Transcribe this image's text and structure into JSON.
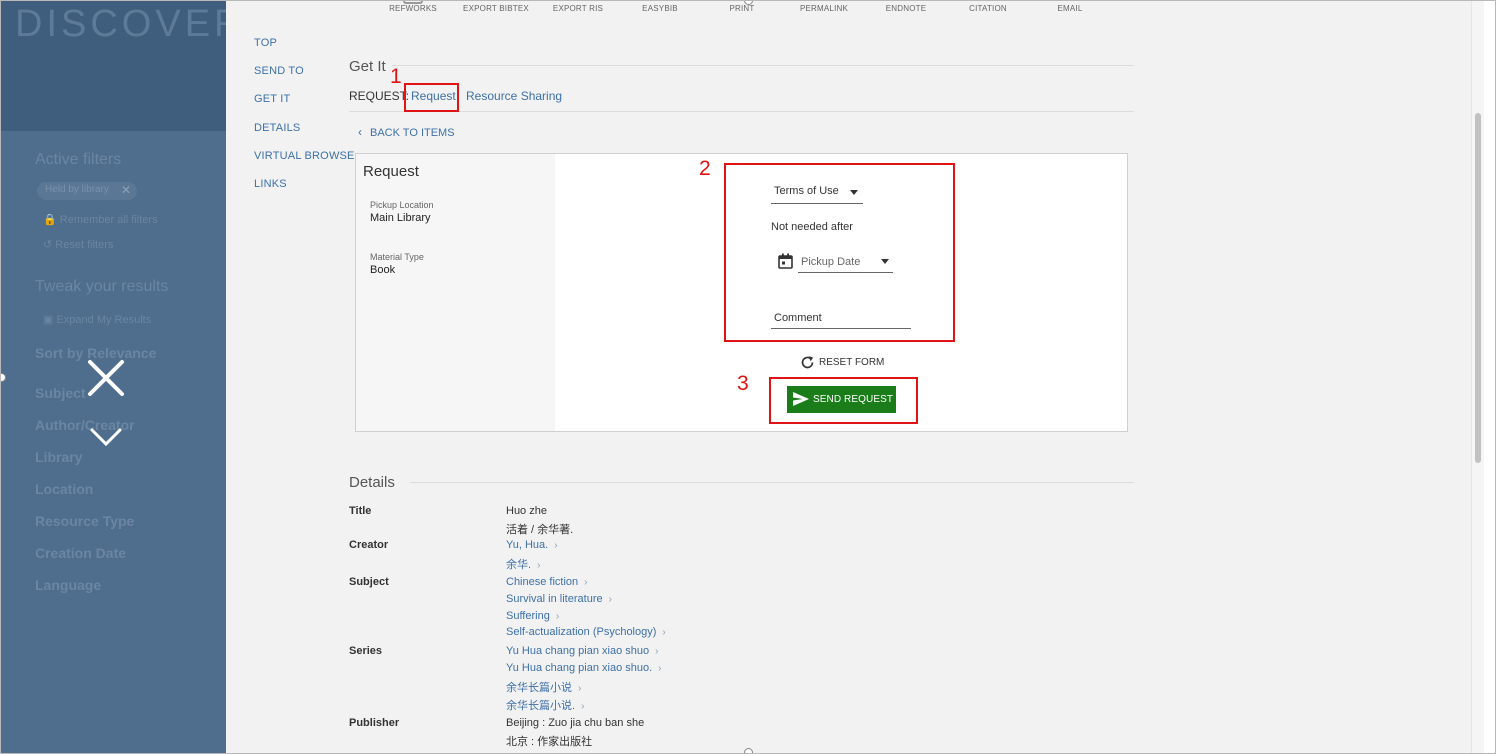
{
  "sidebar": {
    "logo": "DISCOVER",
    "active_filters_heading": "Active filters",
    "chip_label": "Held by library",
    "remember_filters": "Remember all filters",
    "reset_filters": "Reset filters",
    "tweak_heading": "Tweak your results",
    "expand": "Expand My Results",
    "sort_by": "Sort by  Relevance",
    "facets": [
      "Subject",
      "Author/Creator",
      "Library",
      "Location",
      "Resource Type",
      "Creation Date",
      "Language"
    ]
  },
  "toolbar": {
    "actions": [
      "REFWORKS",
      "EXPORT BIBTEX",
      "EXPORT RIS",
      "EASYBIB",
      "PRINT",
      "PERMALINK",
      "ENDNOTE",
      "CITATION",
      "EMAIL"
    ]
  },
  "section_nav": [
    "TOP",
    "SEND TO",
    "GET IT",
    "DETAILS",
    "VIRTUAL BROWSE",
    "LINKS"
  ],
  "get_it": {
    "title": "Get It",
    "request_label": "REQUEST:",
    "option_request": "Request",
    "option_resource_sharing": "Resource Sharing",
    "back_to_items": "BACK TO ITEMS"
  },
  "request_card": {
    "title": "Request",
    "pickup_location_label": "Pickup Location",
    "pickup_location_value": "Main Library",
    "material_type_label": "Material Type",
    "material_type_value": "Book",
    "terms_of_use": "Terms of Use",
    "not_needed_after": "Not needed after",
    "pickup_date_placeholder": "Pickup Date",
    "comment_placeholder": "Comment",
    "reset_form": "RESET FORM",
    "send_request": "SEND REQUEST"
  },
  "annotations": {
    "marker_1": "1",
    "marker_2": "2",
    "marker_3": "3",
    "color": "#e01414"
  },
  "details": {
    "title": "Details",
    "title_label": "Title",
    "title_values": [
      "Huo zhe",
      "活着 / 余华著."
    ],
    "creator_label": "Creator",
    "creator_values": [
      "Yu, Hua.",
      "余华."
    ],
    "subject_label": "Subject",
    "subject_values": [
      "Chinese fiction",
      "Survival in literature",
      "Suffering",
      "Self-actualization (Psychology)"
    ],
    "series_label": "Series",
    "series_values": [
      "Yu Hua chang pian xiao shuo",
      "Yu Hua chang pian xiao shuo.",
      "余华长篇小说",
      "余华长篇小说."
    ],
    "publisher_label": "Publisher",
    "publisher_values": [
      "Beijing : Zuo jia chu ban she",
      "北京 : 作家出版社"
    ]
  },
  "colors": {
    "link": "#3d70a8",
    "send_button": "#1a7d1a",
    "sidebar_overlay": "#4f6d8c"
  }
}
